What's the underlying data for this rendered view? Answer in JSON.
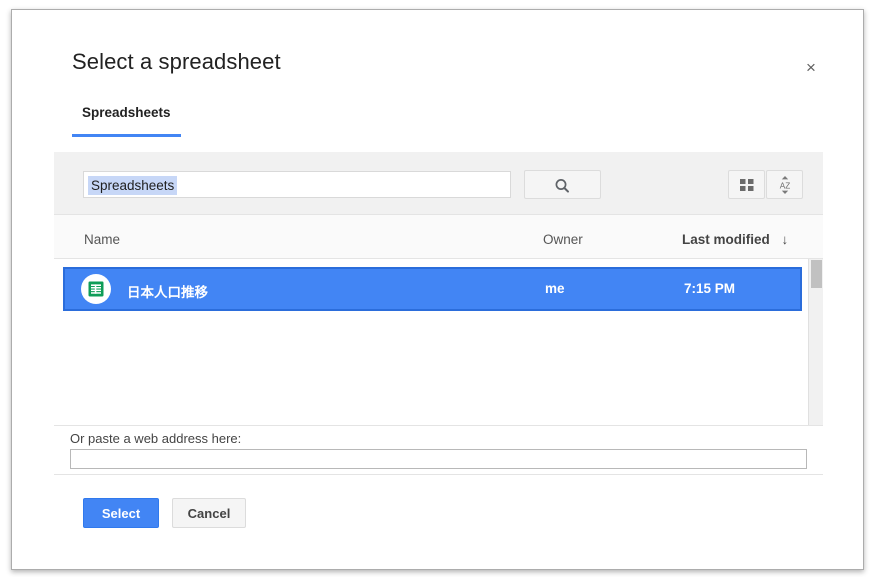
{
  "dialog": {
    "title": "Select a spreadsheet",
    "close_icon": "close-icon",
    "close_label": "×"
  },
  "tabs": [
    {
      "label": "Spreadsheets",
      "active": true
    }
  ],
  "toolbar": {
    "search_value": "Spreadsheets",
    "search_placeholder": "",
    "search_button_icon": "search-icon",
    "grid_view_icon": "grid-view-icon",
    "sort_icon": "sort-az-icon"
  },
  "list": {
    "columns": {
      "name": "Name",
      "owner": "Owner",
      "last_modified": "Last modified",
      "sort_arrow": "↓"
    },
    "rows": [
      {
        "icon": "google-sheets-icon",
        "name": "日本人口推移",
        "owner": "me",
        "last_modified": "7:15 PM",
        "selected": true
      }
    ]
  },
  "url_section": {
    "label": "Or paste a web address here:",
    "value": "",
    "placeholder": ""
  },
  "footer": {
    "select_label": "Select",
    "cancel_label": "Cancel"
  },
  "colors": {
    "accent_blue": "#4285f4",
    "selected_row_border": "#2b6ddb",
    "toolbar_bg": "#f1f1f1",
    "header_bg": "#fafafa",
    "sheets_green": "#0f9d58",
    "chip_highlight": "#c7d7f7"
  }
}
